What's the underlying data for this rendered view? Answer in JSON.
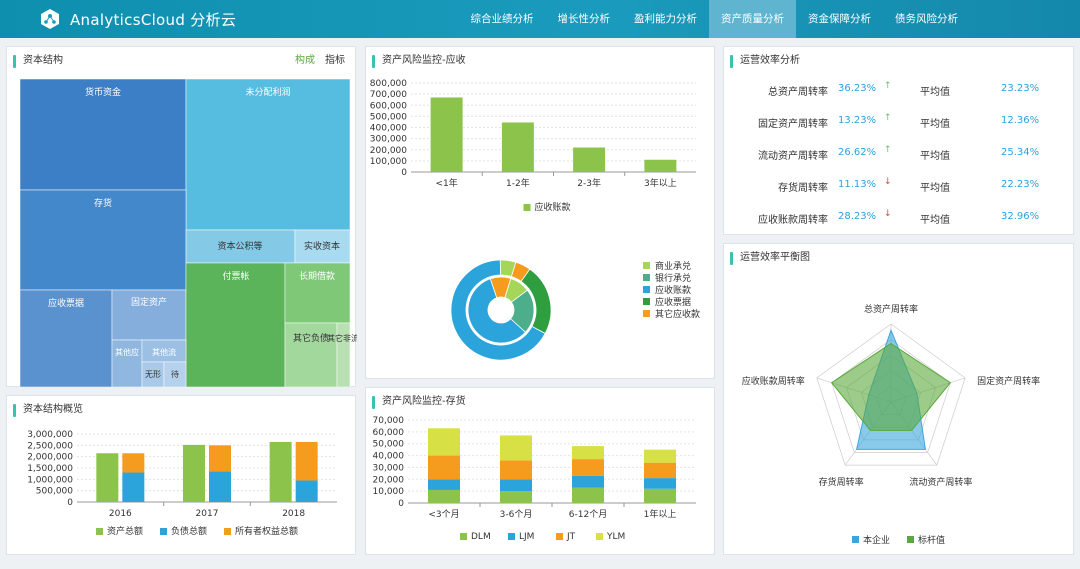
{
  "app": {
    "title": "AnalyticsCloud 分析云"
  },
  "nav": [
    {
      "label": "综合业绩分析",
      "active": false
    },
    {
      "label": "增长性分析",
      "active": false
    },
    {
      "label": "盈利能力分析",
      "active": false
    },
    {
      "label": "资产质量分析",
      "active": true
    },
    {
      "label": "资金保障分析",
      "active": false
    },
    {
      "label": "债务风险分析",
      "active": false
    }
  ],
  "capital_structure": {
    "title": "资本结构",
    "tabs": [
      "构成",
      "指标"
    ],
    "cells": [
      "货币资金",
      "未分配利润",
      "存货",
      "资本公积等",
      "实收资本",
      "应收票据",
      "固定资产",
      "付票帐",
      "长期借款",
      "其它负债",
      "其他应",
      "其他流",
      "无形",
      "待",
      "其它非流"
    ]
  },
  "capital_overview": {
    "title": "资本结构概览",
    "chart_data": {
      "type": "bar",
      "stacked": true,
      "categories": [
        "2016",
        "2017",
        "2018"
      ],
      "series": [
        {
          "name": "资产总额",
          "values": [
            2150000,
            2520000,
            2650000
          ],
          "color": "#8cc34a"
        },
        {
          "name": "负债总额",
          "values": [
            1300000,
            1350000,
            950000
          ],
          "color": "#2ba3db"
        },
        {
          "name": "所有者权益总额",
          "values": [
            850000,
            1150000,
            1700000
          ],
          "color": "#f59b1d"
        }
      ],
      "yticks": [
        "3,000,000",
        "2,500,000",
        "2,000,000",
        "1,500,000",
        "1,000,000",
        "500,000",
        "0"
      ],
      "ylim": [
        0,
        3000000
      ]
    }
  },
  "receivable_risk": {
    "title": "资产风险监控-应收",
    "chart_data": {
      "type": "bar",
      "categories": [
        "<1年",
        "1-2年",
        "2-3年",
        "3年以上"
      ],
      "series": [
        {
          "name": "应收账款",
          "values": [
            670000,
            445000,
            220000,
            110000
          ],
          "color": "#8cc34a"
        }
      ],
      "yticks": [
        "800,000",
        "700,000",
        "600,000",
        "500,000",
        "400,000",
        "300,000",
        "200,000",
        "100,000",
        "0"
      ],
      "ylim": [
        0,
        800000
      ]
    },
    "donut": {
      "legend": [
        {
          "name": "商业承兑",
          "color": "#a5d65a"
        },
        {
          "name": "银行承兑",
          "color": "#4cae8a"
        },
        {
          "name": "应收账款",
          "color": "#2ba3db"
        },
        {
          "name": "应收票据",
          "color": "#2e9e3e"
        },
        {
          "name": "其它应收款",
          "color": "#f59b1d"
        }
      ],
      "inner": [
        0.1,
        0.22,
        0.58,
        0.1
      ],
      "outer": [
        0.05,
        0.23,
        0.67,
        0.05
      ]
    }
  },
  "inventory_risk": {
    "title": "资产风险监控-存货",
    "chart_data": {
      "type": "bar",
      "stacked": true,
      "categories": [
        "<3个月",
        "3-6个月",
        "6-12个月",
        "1年以上"
      ],
      "series": [
        {
          "name": "DLM",
          "values": [
            11000,
            10000,
            13000,
            12000
          ],
          "color": "#8cc34a"
        },
        {
          "name": "LJM",
          "values": [
            9000,
            10000,
            10000,
            9000
          ],
          "color": "#2ba3db"
        },
        {
          "name": "JT",
          "values": [
            20000,
            16000,
            14000,
            13000
          ],
          "color": "#f59b1d"
        },
        {
          "name": "YLM",
          "values": [
            23000,
            21000,
            11000,
            11000
          ],
          "color": "#d7e044"
        }
      ],
      "yticks": [
        "70,000",
        "60,000",
        "50,000",
        "40,000",
        "30,000",
        "20,000",
        "10,000",
        "0"
      ],
      "ylim": [
        0,
        70000
      ]
    }
  },
  "efficiency": {
    "title": "运营效率分析",
    "avg_label": "平均值",
    "rows": [
      {
        "name": "总资产周转率",
        "value": "36.23%",
        "trend": "up",
        "avg": "23.23%"
      },
      {
        "name": "固定资产周转率",
        "value": "13.23%",
        "trend": "up",
        "avg": "12.36%"
      },
      {
        "name": "流动资产周转率",
        "value": "26.62%",
        "trend": "up",
        "avg": "25.34%"
      },
      {
        "name": "存货周转率",
        "value": "11.13%",
        "trend": "down",
        "avg": "22.23%"
      },
      {
        "name": "应收账款周转率",
        "value": "28.23%",
        "trend": "down",
        "avg": "32.96%"
      }
    ]
  },
  "radar": {
    "title": "运营效率平衡图",
    "axes": [
      "总资产周转率",
      "固定资产周转率",
      "流动资产周转率",
      "存货周转率",
      "应收账款周转率"
    ],
    "series": [
      {
        "name": "本企业",
        "values": [
          0.92,
          0.35,
          0.75,
          0.75,
          0.3
        ],
        "color": "#3aa6dc"
      },
      {
        "name": "标杆值",
        "values": [
          0.75,
          0.8,
          0.45,
          0.45,
          0.8
        ],
        "color": "#5aa83c"
      }
    ]
  }
}
